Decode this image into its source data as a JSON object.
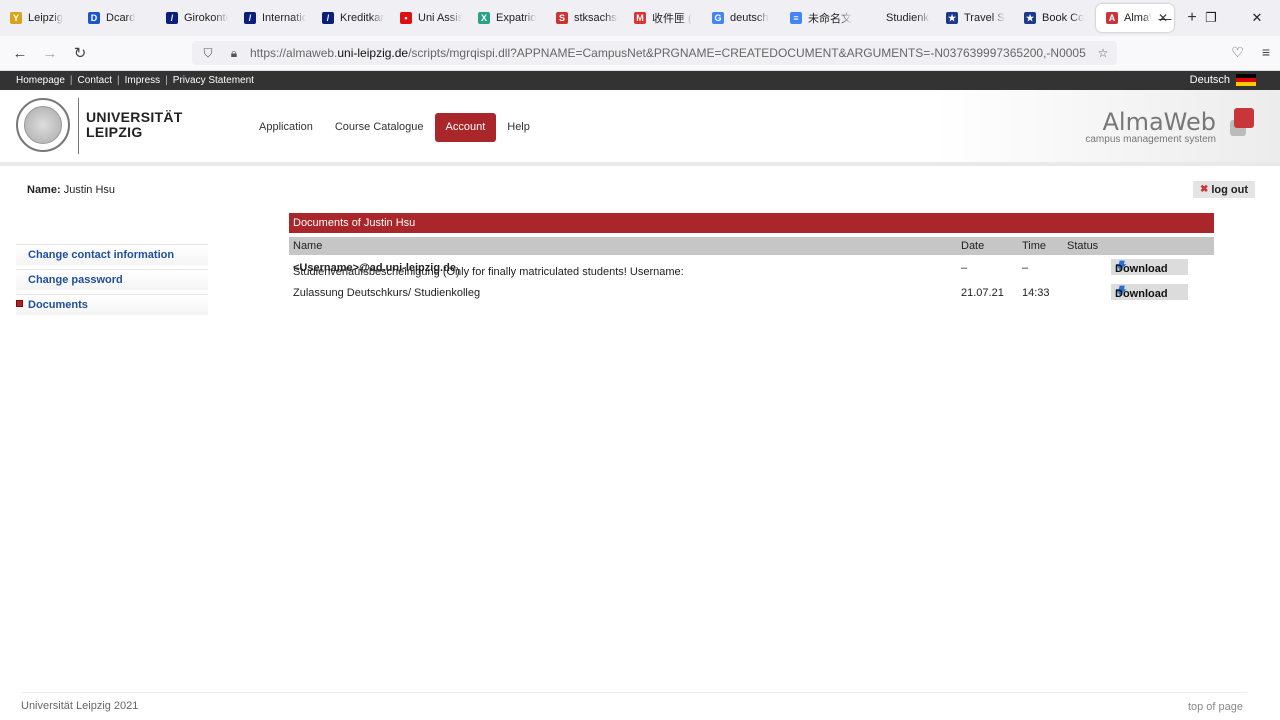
{
  "browser": {
    "tabs": [
      {
        "title": "Leipzig",
        "color": "#d9a31c",
        "glyph": "Y"
      },
      {
        "title": "Dcard",
        "color": "#1a56c9",
        "glyph": "D"
      },
      {
        "title": "Girokonto",
        "color": "#0a1f7a",
        "glyph": "/"
      },
      {
        "title": "International",
        "color": "#0a1f7a",
        "glyph": "/"
      },
      {
        "title": "Kreditkarte",
        "color": "#0a1f7a",
        "glyph": "/"
      },
      {
        "title": "Uni Assist",
        "color": "#d11",
        "glyph": "•"
      },
      {
        "title": "Expatrio",
        "color": "#27a38a",
        "glyph": "X"
      },
      {
        "title": "stksachsen",
        "color": "#c33",
        "glyph": "S"
      },
      {
        "title": "收件匣 (",
        "color": "#d33",
        "glyph": "M"
      },
      {
        "title": "deutsch",
        "color": "#4285f4",
        "glyph": "G"
      },
      {
        "title": "未命名文件",
        "color": "#4285f4",
        "glyph": "≡"
      },
      {
        "title": "Studienkolleg",
        "color": "#f0f0f4",
        "glyph": ""
      },
      {
        "title": "Travel S",
        "color": "#1b3a8c",
        "glyph": "★"
      },
      {
        "title": "Book Co",
        "color": "#1b3a8c",
        "glyph": "★"
      }
    ],
    "active_tab": {
      "title": "AlmaWeb",
      "color": "#c8363b",
      "glyph": "A"
    },
    "url_prefix": "https://almaweb.",
    "url_domain": "uni-leipzig.de",
    "url_rest": "/scripts/mgrqispi.dll?APPNAME=CampusNet&PRGNAME=CREATEDOCUMENT&ARGUMENTS=-N037639997365200,-N0005"
  },
  "topstrip": {
    "links": [
      "Homepage",
      "Contact",
      "Impress",
      "Privacy Statement"
    ],
    "language": "Deutsch"
  },
  "header": {
    "university_line1": "UNIVERSITÄT",
    "university_line2": "LEIPZIG",
    "nav": [
      "Application",
      "Course Catalogue",
      "Account",
      "Help"
    ],
    "active_nav": "Account",
    "brand": "AlmaWeb",
    "brand_sub": "campus management system"
  },
  "user": {
    "name_label": "Name:",
    "name": "Justin Hsu"
  },
  "logout_label": "log out",
  "sidebar": {
    "items": [
      {
        "label": "Change contact information",
        "active": false
      },
      {
        "label": "Change password",
        "active": false
      },
      {
        "label": "Documents",
        "active": true
      }
    ]
  },
  "documents": {
    "caption": "Documents of Justin Hsu",
    "columns": {
      "name": "Name",
      "date": "Date",
      "time": "Time",
      "status": "Status"
    },
    "rows": [
      {
        "name": "Studienverlaufsbescheinigung (Only for finally matriculated students! Username: ",
        "name_bold": "<Username>@ad.uni-leipzig.de",
        "name_tail": ")",
        "date": "–",
        "time": "–",
        "status": "",
        "action": "Download"
      },
      {
        "name": "Zulassung Deutschkurs/ Studienkolleg",
        "name_bold": "",
        "name_tail": "",
        "date": "21.07.21",
        "time": "14:33",
        "status": "",
        "action": "Download"
      }
    ]
  },
  "footer": {
    "copyright": "Universität Leipzig 2021",
    "top_link": "top of page"
  }
}
